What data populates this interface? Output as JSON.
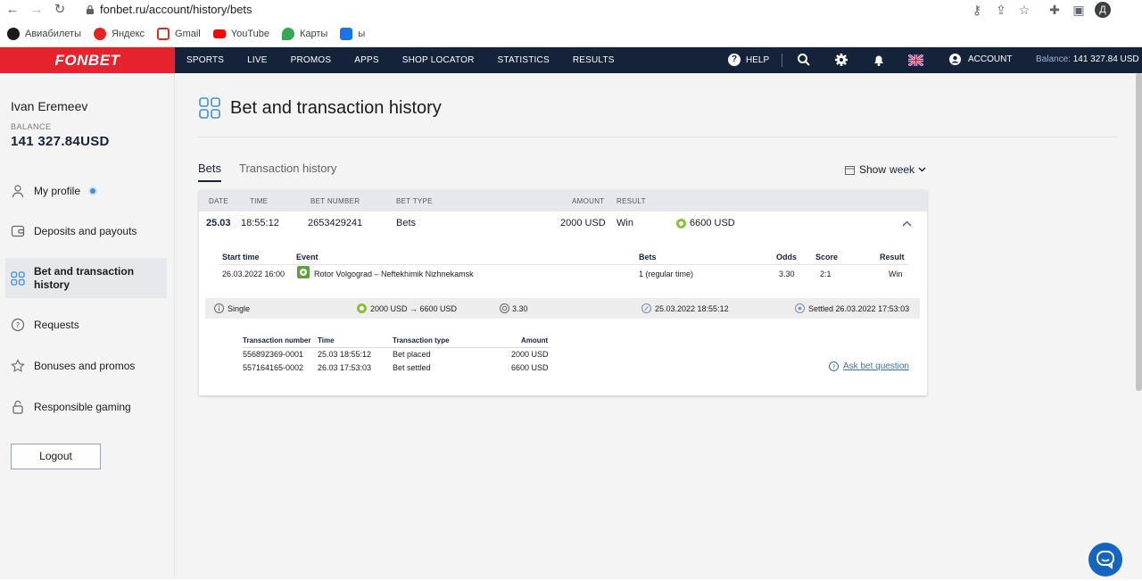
{
  "browser": {
    "url": "fonbet.ru/account/history/bets",
    "bookmarks": [
      {
        "label": "Авиабилеты",
        "color": "#1a1a1a"
      },
      {
        "label": "Яндекс",
        "color": "#e52620"
      },
      {
        "label": "Gmail",
        "color": "#d93025"
      },
      {
        "label": "YouTube",
        "color": "#ff0000"
      },
      {
        "label": "Карты",
        "color": "#34a853"
      },
      {
        "label": "ы",
        "color": "#1a73e8"
      }
    ],
    "profile_initial": "Д"
  },
  "topnav": {
    "logo": "FONBET",
    "menu": [
      "SPORTS",
      "LIVE",
      "PROMOS",
      "APPS",
      "SHOP LOCATOR",
      "STATISTICS",
      "RESULTS"
    ],
    "help": "HELP",
    "account": "ACCOUNT",
    "balance_label": "Balance:",
    "balance_value": "141 327.84 USD"
  },
  "sidebar": {
    "user_name": "Ivan Eremeev",
    "balance_label": "BALANCE",
    "balance_value": "141 327.84USD",
    "items": [
      {
        "label": "My profile",
        "icon": "user-icon"
      },
      {
        "label": "Deposits and payouts",
        "icon": "wallet-icon"
      },
      {
        "label": "Bet and transaction history",
        "icon": "grid-icon"
      },
      {
        "label": "Requests",
        "icon": "question-icon"
      },
      {
        "label": "Bonuses and promos",
        "icon": "star-icon"
      },
      {
        "label": "Responsible gaming",
        "icon": "lock-icon"
      }
    ],
    "logout": "Logout"
  },
  "main": {
    "title": "Bet and transaction history",
    "tabs": [
      "Bets",
      "Transaction history"
    ],
    "show_label": "Show",
    "show_value": "week",
    "table": {
      "headers": [
        "DATE",
        "TIME",
        "BET NUMBER",
        "BET TYPE",
        "AMOUNT",
        "RESULT"
      ],
      "row": {
        "date": "25.03",
        "time": "18:55:12",
        "bet_number": "2653429241",
        "bet_type": "Bets",
        "amount": "2000 USD",
        "result": "Win",
        "payout": "6600 USD"
      },
      "details": {
        "headers": [
          "Start time",
          "Event",
          "Bets",
          "Odds",
          "Score",
          "Result"
        ],
        "row": {
          "start_time": "26.03.2022 16:00",
          "event": "Rotor Volgograd – Neftekhimik Nizhnekamsk",
          "bets": "1 (regular time)",
          "odds": "3.30",
          "score": "2:1",
          "result": "Win"
        }
      },
      "summary": {
        "type": "Single",
        "flow": "2000 USD → 6600 USD",
        "odds": "3.30",
        "placed": "25.03.2022 18:55:12",
        "settled": "Settled 26.03.2022 17:53:03"
      },
      "transactions": {
        "headers": [
          "Transaction number",
          "Time",
          "Transaction type",
          "Amount"
        ],
        "rows": [
          {
            "number": "556892369-0001",
            "time": "25.03 18:55:12",
            "type": "Bet placed",
            "amount": "2000 USD"
          },
          {
            "number": "557164165-0002",
            "time": "26.03 17:53:03",
            "type": "Bet settled",
            "amount": "6600 USD"
          }
        ]
      },
      "ask": "Ask bet question"
    }
  }
}
